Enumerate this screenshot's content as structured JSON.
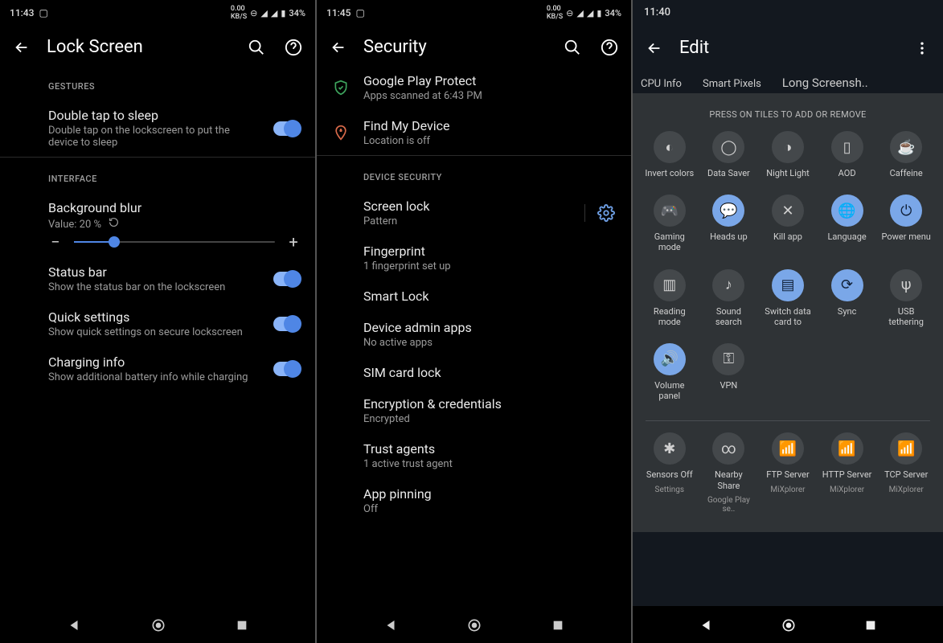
{
  "panel1": {
    "status": {
      "time": "11:43",
      "battery": "34%"
    },
    "appbar": {
      "title": "Lock Screen"
    },
    "sections": {
      "gestures_label": "GESTURES",
      "interface_label": "INTERFACE"
    },
    "double_tap": {
      "title": "Double tap to sleep",
      "sub": "Double tap on the lockscreen to put the device to sleep"
    },
    "bg_blur": {
      "title": "Background blur",
      "sub": "Value: 20 %",
      "minus": "−",
      "plus": "+"
    },
    "status_bar": {
      "title": "Status bar",
      "sub": "Show the status bar on the lockscreen"
    },
    "quick_settings": {
      "title": "Quick settings",
      "sub": "Show quick settings on secure lockscreen"
    },
    "charging": {
      "title": "Charging info",
      "sub": "Show additional battery info while charging"
    }
  },
  "panel2": {
    "status": {
      "time": "11:45",
      "battery": "34%"
    },
    "appbar": {
      "title": "Security"
    },
    "play_protect": {
      "title": "Google Play Protect",
      "sub": "Apps scanned at 6:43 PM"
    },
    "find_device": {
      "title": "Find My Device",
      "sub": "Location is off"
    },
    "section_label": "DEVICE SECURITY",
    "screen_lock": {
      "title": "Screen lock",
      "sub": "Pattern"
    },
    "fingerprint": {
      "title": "Fingerprint",
      "sub": "1 fingerprint set up"
    },
    "smart_lock": {
      "title": "Smart Lock"
    },
    "admin_apps": {
      "title": "Device admin apps",
      "sub": "No active apps"
    },
    "sim_lock": {
      "title": "SIM card lock"
    },
    "encryption": {
      "title": "Encryption & credentials",
      "sub": "Encrypted"
    },
    "trust_agents": {
      "title": "Trust agents",
      "sub": "1 active trust agent"
    },
    "app_pinning": {
      "title": "App pinning",
      "sub": "Off"
    }
  },
  "panel3": {
    "status": {
      "time": "11:40"
    },
    "appbar": {
      "title": "Edit"
    },
    "tabs": {
      "cpu": "CPU Info",
      "pixels": "Smart Pixels",
      "longss": "Long Screensh.."
    },
    "hint": "PRESS ON TILES TO ADD OR REMOVE",
    "tiles_top": [
      {
        "name": "invert-colors",
        "label": "Invert colors",
        "icon": "◐",
        "on": false
      },
      {
        "name": "data-saver",
        "label": "Data Saver",
        "icon": "◯",
        "on": false
      },
      {
        "name": "night-light",
        "label": "Night Light",
        "icon": "◑",
        "on": false
      },
      {
        "name": "aod",
        "label": "AOD",
        "icon": "▯",
        "on": false
      },
      {
        "name": "caffeine",
        "label": "Caffeine",
        "icon": "☕",
        "on": false
      },
      {
        "name": "gaming-mode",
        "label": "Gaming mode",
        "icon": "🎮",
        "on": false
      },
      {
        "name": "heads-up",
        "label": "Heads up",
        "icon": "💬",
        "on": true
      },
      {
        "name": "kill-app",
        "label": "Kill app",
        "icon": "✕",
        "on": false
      },
      {
        "name": "language",
        "label": "Language",
        "icon": "🌐",
        "on": true
      },
      {
        "name": "power-menu",
        "label": "Power menu",
        "icon": "⏻",
        "on": true
      },
      {
        "name": "reading-mode",
        "label": "Reading mode",
        "icon": "▥",
        "on": false
      },
      {
        "name": "sound-search",
        "label": "Sound search",
        "icon": "♪",
        "on": false
      },
      {
        "name": "switch-data",
        "label": "Switch data card to",
        "icon": "▤",
        "on": true
      },
      {
        "name": "sync",
        "label": "Sync",
        "icon": "⟳",
        "on": true
      },
      {
        "name": "usb-tethering",
        "label": "USB tethering",
        "icon": "ψ",
        "on": false
      },
      {
        "name": "volume-panel",
        "label": "Volume panel",
        "icon": "🔊",
        "on": true
      },
      {
        "name": "vpn",
        "label": "VPN",
        "icon": "⚿",
        "on": false
      }
    ],
    "tiles_bottom": [
      {
        "name": "sensors-off",
        "label": "Sensors Off",
        "sub": "Settings",
        "icon": "✱",
        "on": false
      },
      {
        "name": "nearby-share",
        "label": "Nearby Share",
        "sub": "Google Play se..",
        "icon": "∞",
        "on": false
      },
      {
        "name": "ftp-server",
        "label": "FTP Server",
        "sub": "MiXplorer",
        "icon": "📶",
        "on": false
      },
      {
        "name": "http-server",
        "label": "HTTP Server",
        "sub": "MiXplorer",
        "icon": "📶",
        "on": false
      },
      {
        "name": "tcp-server",
        "label": "TCP Server",
        "sub": "MiXplorer",
        "icon": "📶",
        "on": false
      }
    ]
  }
}
